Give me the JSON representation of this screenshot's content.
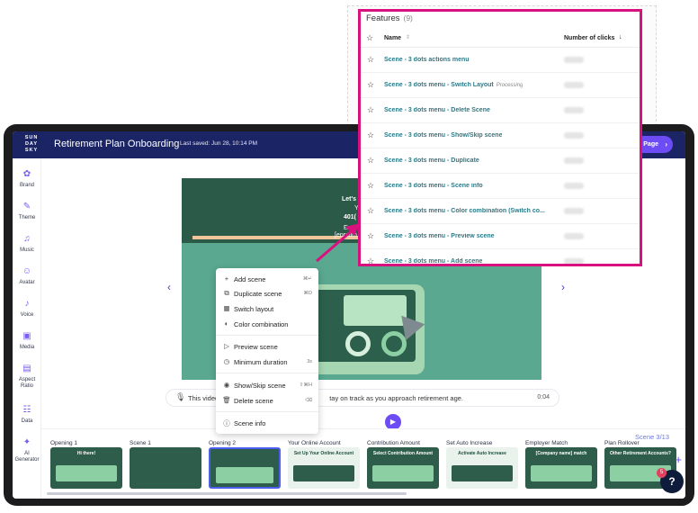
{
  "app": {
    "logo": "SUN DAY SKY",
    "title": "Retirement Plan Onboarding",
    "last_saved": "Last saved: Jun 28, 10:14 PM",
    "page_button": "Page"
  },
  "sidebar": {
    "items": [
      {
        "label": "Brand",
        "icon": "brand-icon"
      },
      {
        "label": "Theme",
        "icon": "theme-icon"
      },
      {
        "label": "Music",
        "icon": "music-icon"
      },
      {
        "label": "Avatar",
        "icon": "avatar-icon"
      },
      {
        "label": "Voice",
        "icon": "voice-icon"
      },
      {
        "label": "Media",
        "icon": "media-icon"
      },
      {
        "label": "Aspect Ratio",
        "icon": "aspect-ratio-icon"
      },
      {
        "label": "Data",
        "icon": "data-icon"
      },
      {
        "label": "AI Generator",
        "icon": "ai-generator-icon"
      }
    ]
  },
  "slide": {
    "line1": "Let's",
    "line2": "Y",
    "line3": "401(",
    "line4": "Enro",
    "line5": "[enrollm"
  },
  "narration": {
    "text": "This video will help you stay on track as you approach retirement age.",
    "text_visible": "This video",
    "text_visible_tail": "tay on track as you approach retirement age.",
    "duration": "0:04"
  },
  "context_menu": {
    "items": [
      {
        "label": "Add scene",
        "shortcut": "⌘↵",
        "icon": "plus-icon"
      },
      {
        "label": "Duplicate scene",
        "shortcut": "⌘D",
        "icon": "duplicate-icon"
      },
      {
        "label": "Switch layout",
        "shortcut": "",
        "icon": "layout-icon"
      },
      {
        "label": "Color combination",
        "shortcut": "",
        "icon": "palette-icon"
      },
      {
        "label": "Preview scene",
        "shortcut": "",
        "icon": "play-icon"
      },
      {
        "label": "Minimum duration",
        "shortcut": "3s",
        "icon": "clock-icon"
      },
      {
        "label": "Show/Skip scene",
        "shortcut": "⇧⌘H",
        "icon": "eye-icon"
      },
      {
        "label": "Delete scene",
        "shortcut": "⌫",
        "icon": "trash-icon"
      },
      {
        "label": "Scene info",
        "shortcut": "",
        "icon": "info-icon"
      }
    ]
  },
  "timeline": {
    "scene_count": "Scene 3/13",
    "scenes": [
      {
        "label": "Opening 1",
        "thumb_title": "Hi there!",
        "theme": "dark"
      },
      {
        "label": "Scene 1",
        "thumb_title": "",
        "theme": "dark"
      },
      {
        "label": "Opening 2",
        "thumb_title": "",
        "theme": "dark"
      },
      {
        "label": "Your Online Account",
        "thumb_title": "Set Up Your Online Account",
        "theme": "light"
      },
      {
        "label": "Contribution Amount",
        "thumb_title": "Select Contribution Amount",
        "theme": "dark"
      },
      {
        "label": "Set Auto Increase",
        "thumb_title": "Activate Auto Increase",
        "theme": "light"
      },
      {
        "label": "Employer Match",
        "thumb_title": "[Company name] match",
        "theme": "dark"
      },
      {
        "label": "Plan Rollover",
        "thumb_title": "Other Retirement Accounts?",
        "theme": "dark"
      }
    ],
    "help_badge": "5",
    "help_label": "?"
  },
  "features": {
    "title": "Features",
    "count": "(9)",
    "col_name": "Name",
    "col_clicks": "Number of clicks",
    "rows": [
      {
        "name": "Scene - 3 dots actions menu",
        "tag": ""
      },
      {
        "name": "Scene - 3 dots menu - Switch Layout",
        "tag": "Processing"
      },
      {
        "name": "Scene - 3 dots menu - Delete Scene",
        "tag": ""
      },
      {
        "name": "Scene - 3 dots menu - Show/Skip scene",
        "tag": ""
      },
      {
        "name": "Scene - 3 dots menu - Duplicate",
        "tag": ""
      },
      {
        "name": "Scene - 3 dots menu - Scene info",
        "tag": ""
      },
      {
        "name": "Scene - 3 dots menu - Color combination (Switch co...",
        "tag": ""
      },
      {
        "name": "Scene - 3 dots menu - Preview scene",
        "tag": ""
      },
      {
        "name": "Scene - 3 dots menu - Add scene",
        "tag": ""
      }
    ]
  },
  "colors": {
    "brand_navy": "#1b2566",
    "accent_purple": "#6d4cf5",
    "highlight_pink": "#d9117f",
    "feature_link": "#2e7a87"
  }
}
